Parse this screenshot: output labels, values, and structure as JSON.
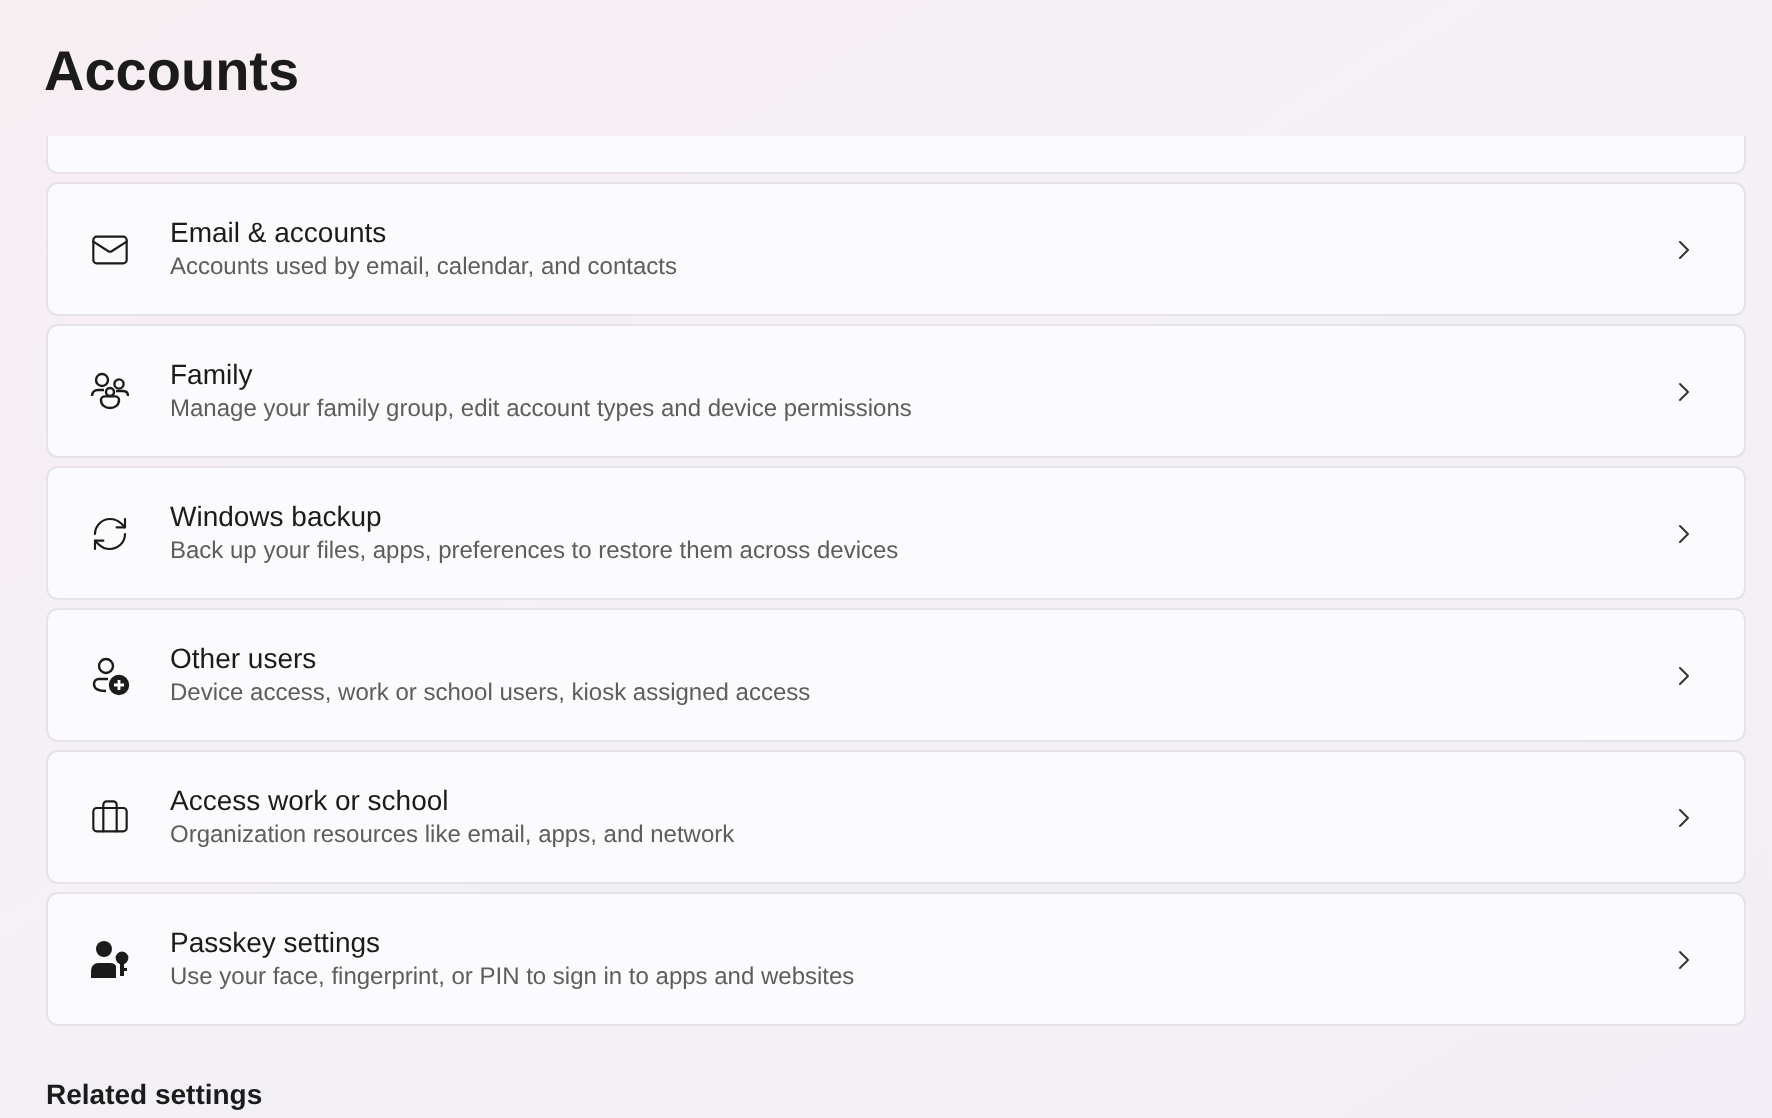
{
  "title": "Accounts",
  "items": [
    {
      "kind": "mail",
      "title": "Email & accounts",
      "subtitle": "Accounts used by email, calendar, and contacts"
    },
    {
      "kind": "family",
      "title": "Family",
      "subtitle": "Manage your family group, edit account types and device permissions"
    },
    {
      "kind": "backup",
      "title": "Windows backup",
      "subtitle": "Back up your files, apps, preferences to restore them across devices"
    },
    {
      "kind": "users",
      "title": "Other users",
      "subtitle": "Device access, work or school users, kiosk assigned access"
    },
    {
      "kind": "work",
      "title": "Access work or school",
      "subtitle": "Organization resources like email, apps, and network"
    },
    {
      "kind": "passkey",
      "title": "Passkey settings",
      "subtitle": "Use your face, fingerprint, or PIN to sign in to apps and websites"
    }
  ],
  "related_heading": "Related settings"
}
